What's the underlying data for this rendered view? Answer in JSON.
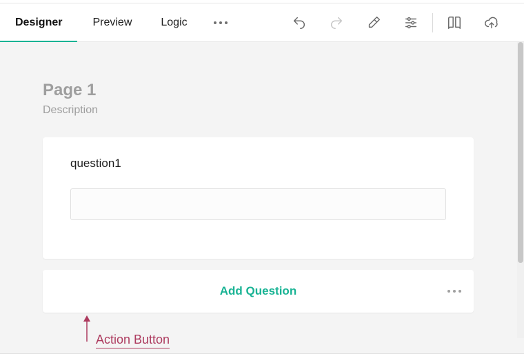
{
  "header": {
    "tabs": [
      {
        "label": "Designer",
        "active": true
      },
      {
        "label": "Preview",
        "active": false
      },
      {
        "label": "Logic",
        "active": false
      }
    ],
    "icons": {
      "more": "more-icon",
      "undo": "undo-icon",
      "redo": "redo-icon",
      "eraser": "eraser-icon",
      "settings": "settings-icon",
      "book": "book-icon",
      "publish": "cloud-upload-icon"
    }
  },
  "page": {
    "title": "Page 1",
    "description": "Description"
  },
  "question": {
    "label": "question1",
    "value": ""
  },
  "add_question": {
    "label": "Add Question"
  },
  "annotation": {
    "label": "Action Button"
  },
  "colors": {
    "accent": "#19b394",
    "annotation": "#ad3b5f"
  }
}
